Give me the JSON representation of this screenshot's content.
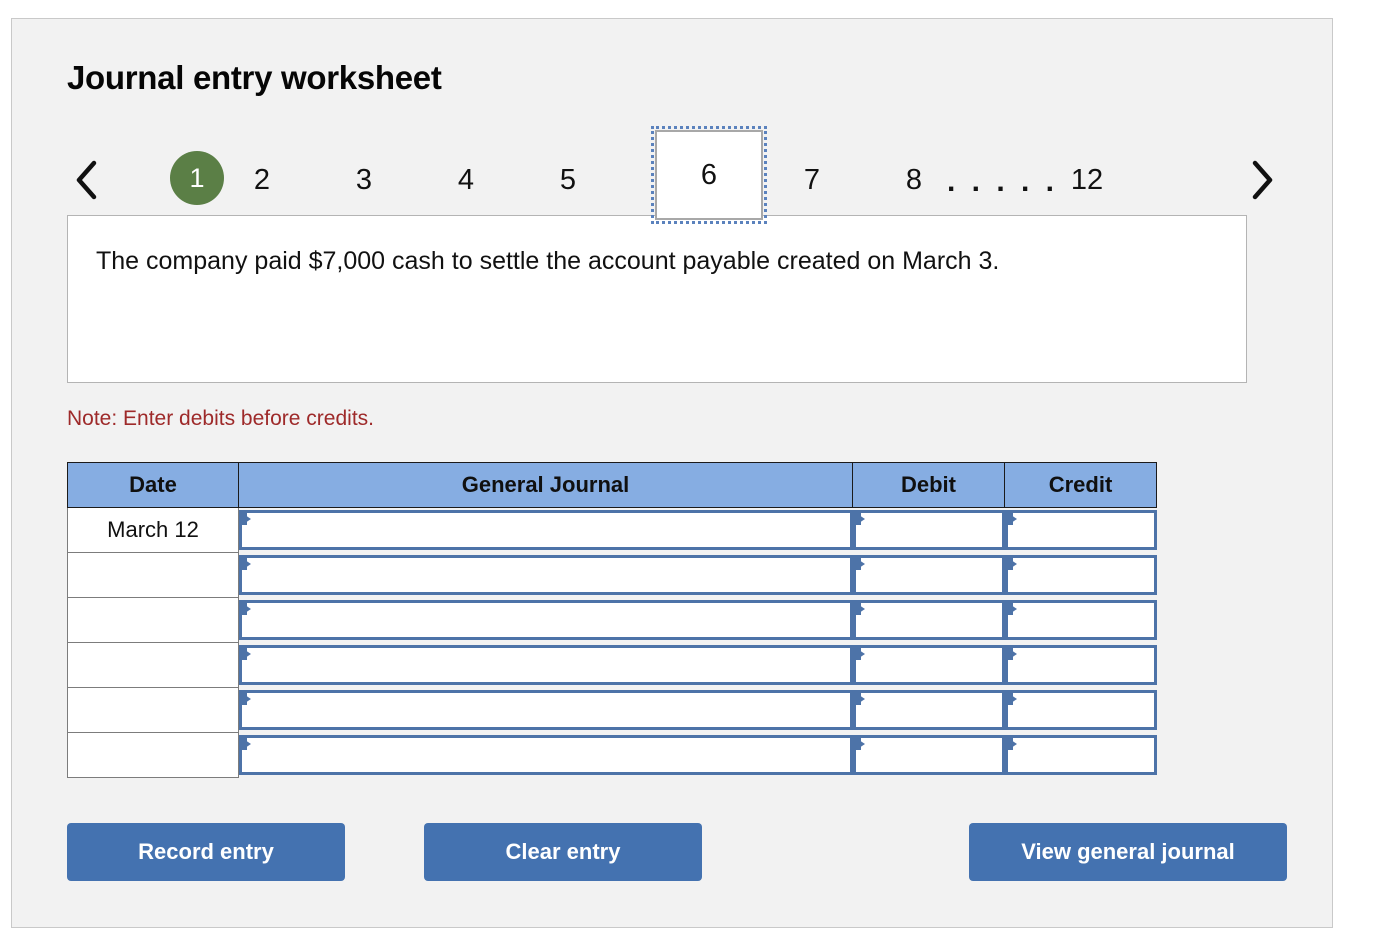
{
  "page": {
    "title": "Journal entry worksheet"
  },
  "pager": {
    "prev_icon": "chevron-left-icon",
    "next_icon": "chevron-right-icon",
    "current_page": "1",
    "selected_page": "6",
    "ellipsis": ". . . . .",
    "pages": [
      "1",
      "2",
      "3",
      "4",
      "5",
      "6",
      "7",
      "8",
      "12"
    ],
    "page_2": "2",
    "page_3": "3",
    "page_4": "4",
    "page_5": "5",
    "page_7": "7",
    "page_8": "8",
    "page_12": "12"
  },
  "description": {
    "text": "The company paid $7,000 cash to settle the account payable created on March 3."
  },
  "note": {
    "text": "Note: Enter debits before credits."
  },
  "table": {
    "headers": {
      "date": "Date",
      "general_journal": "General Journal",
      "debit": "Debit",
      "credit": "Credit"
    },
    "rows": [
      {
        "date": "March 12",
        "general_journal": "",
        "debit": "",
        "credit": ""
      },
      {
        "date": "",
        "general_journal": "",
        "debit": "",
        "credit": ""
      },
      {
        "date": "",
        "general_journal": "",
        "debit": "",
        "credit": ""
      },
      {
        "date": "",
        "general_journal": "",
        "debit": "",
        "credit": ""
      },
      {
        "date": "",
        "general_journal": "",
        "debit": "",
        "credit": ""
      },
      {
        "date": "",
        "general_journal": "",
        "debit": "",
        "credit": ""
      }
    ]
  },
  "buttons": {
    "record": "Record entry",
    "clear": "Clear entry",
    "view": "View general journal"
  },
  "colors": {
    "panel_background": "#f2f2f2",
    "header_blue": "#86ade2",
    "input_border_blue": "#4d73a8",
    "button_blue": "#4472b0",
    "current_page_green": "#5b7f46",
    "note_red": "#9e2a2a",
    "selection_dotted_blue": "#5b82bd"
  }
}
